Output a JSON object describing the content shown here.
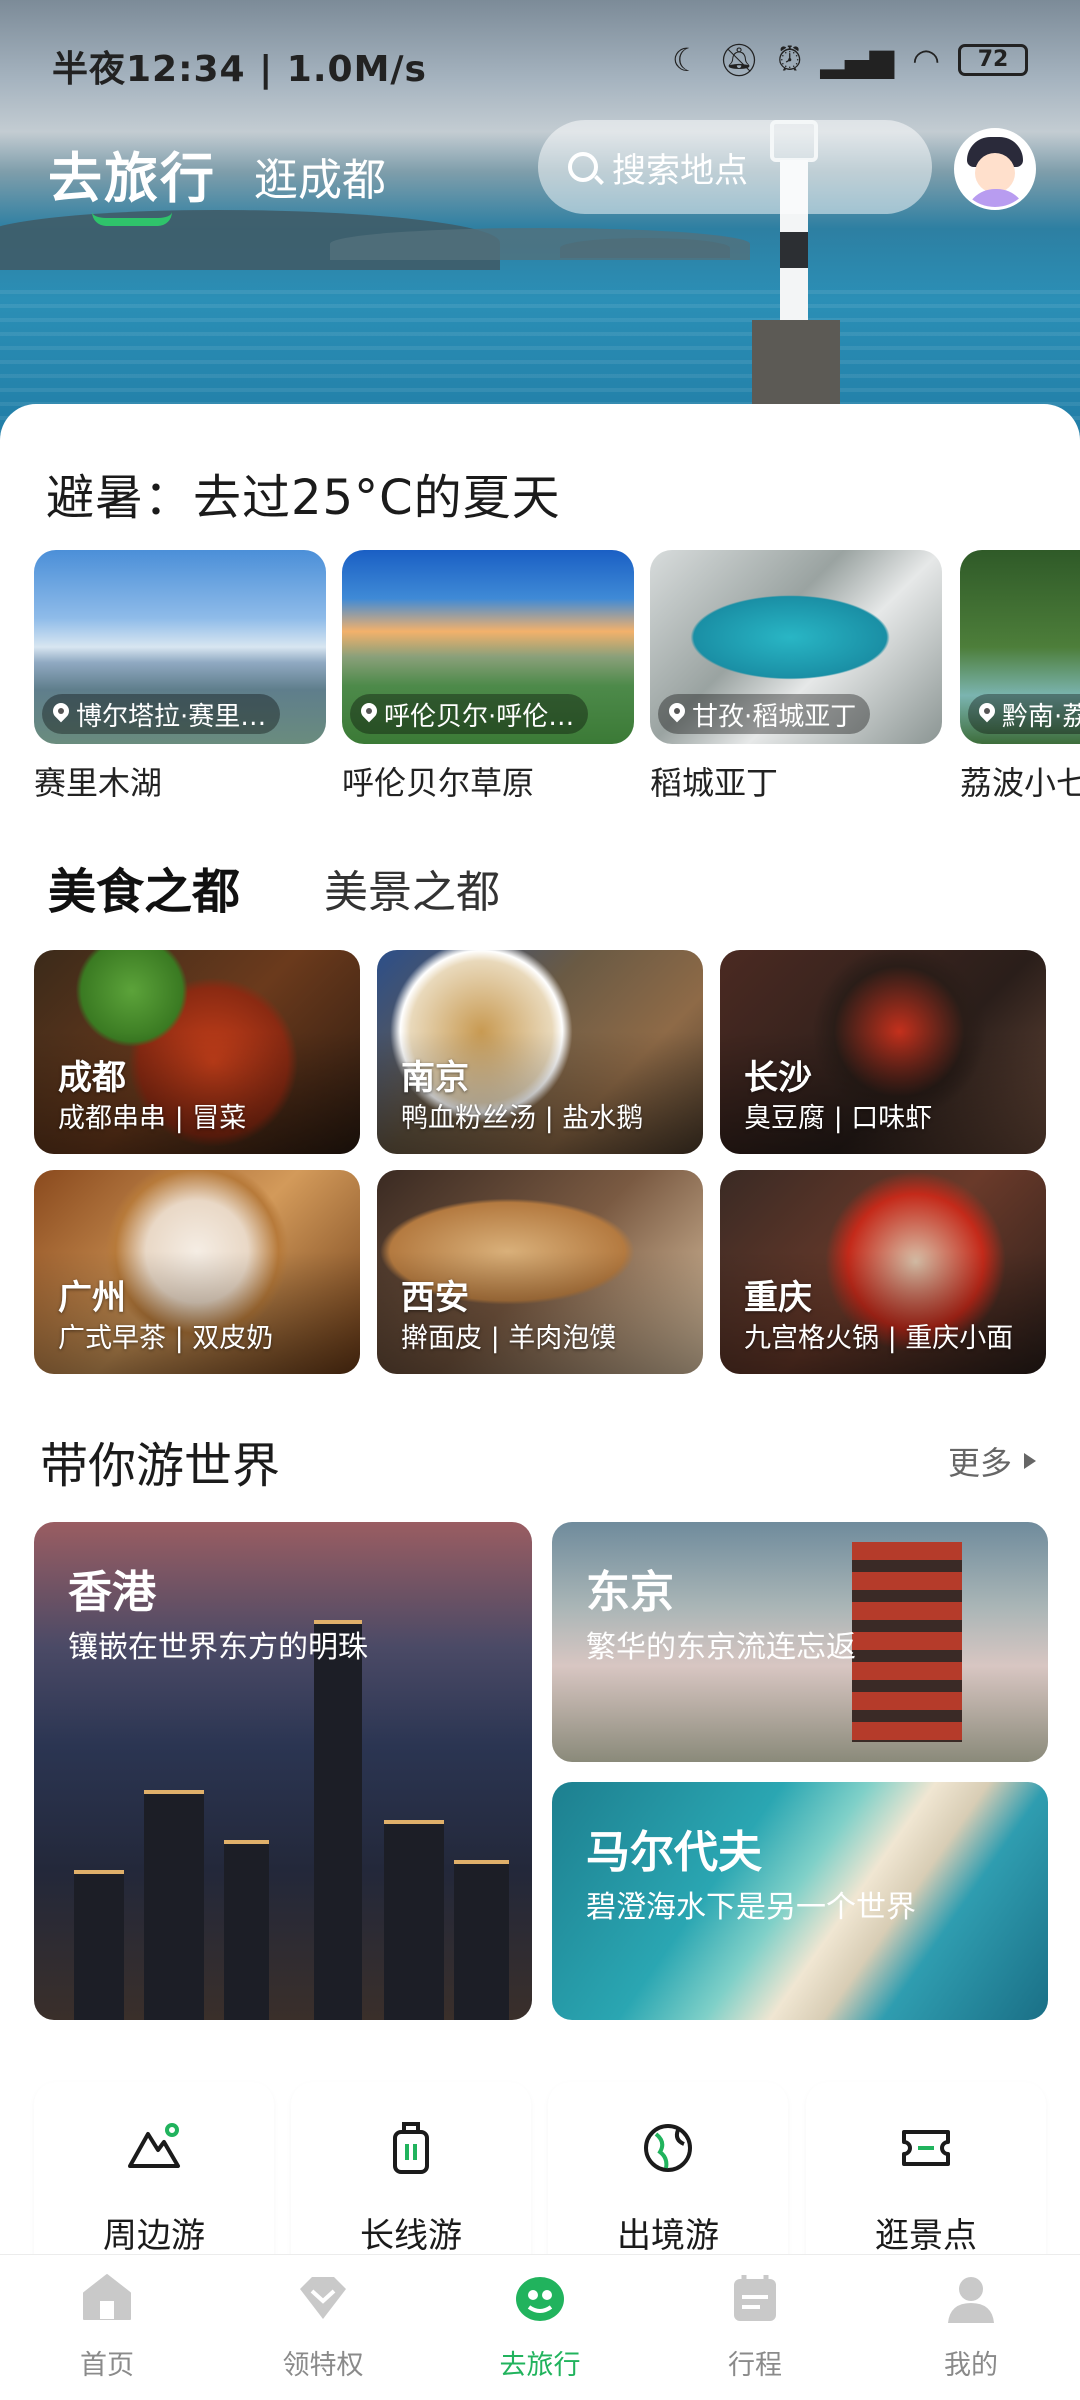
{
  "status_bar": {
    "time": "半夜12:34 | 1.0M/s",
    "battery": "72"
  },
  "header": {
    "tab_main": "去旅行",
    "tab_second": "逛成都",
    "search_placeholder": "搜索地点"
  },
  "summer": {
    "title": "避暑：去过25°C的夏天",
    "cards": [
      {
        "location": "博尔塔拉·赛里…",
        "name": "赛里木湖"
      },
      {
        "location": "呼伦贝尔·呼伦…",
        "name": "呼伦贝尔草原"
      },
      {
        "location": "甘孜·稻城亚丁",
        "name": "稻城亚丁"
      },
      {
        "location": "黔南·荔",
        "name": "荔波小七"
      }
    ]
  },
  "food_tabs": {
    "active": "美食之都",
    "inactive": "美景之都"
  },
  "food_cards": [
    {
      "city": "成都",
      "dishes": "成都串串 | 冒菜"
    },
    {
      "city": "南京",
      "dishes": "鸭血粉丝汤 | 盐水鹅"
    },
    {
      "city": "长沙",
      "dishes": "臭豆腐 | 口味虾"
    },
    {
      "city": "广州",
      "dishes": "广式早茶 | 双皮奶"
    },
    {
      "city": "西安",
      "dishes": "擀面皮 | 羊肉泡馍"
    },
    {
      "city": "重庆",
      "dishes": "九宫格火锅 | 重庆小面"
    }
  ],
  "world": {
    "title": "带你游世界",
    "more": "更多",
    "cards": [
      {
        "title": "香港",
        "subtitle": "镶嵌在世界东方的明珠"
      },
      {
        "title": "东京",
        "subtitle": "繁华的东京流连忘返"
      },
      {
        "title": "马尔代夫",
        "subtitle": "碧澄海水下是另一个世界"
      }
    ]
  },
  "quick_actions": [
    {
      "label": "周边游",
      "icon": "mountain-icon"
    },
    {
      "label": "长线游",
      "icon": "luggage-icon"
    },
    {
      "label": "出境游",
      "icon": "globe-icon"
    },
    {
      "label": "逛景点",
      "icon": "ticket-icon"
    }
  ],
  "tab_bar": [
    {
      "label": "首页",
      "icon": "home-icon"
    },
    {
      "label": "领特权",
      "icon": "diamond-icon"
    },
    {
      "label": "去旅行",
      "icon": "travel-icon",
      "active": true
    },
    {
      "label": "行程",
      "icon": "itinerary-icon"
    },
    {
      "label": "我的",
      "icon": "profile-icon"
    }
  ],
  "colors": {
    "accent": "#21b35d",
    "inactive_tab": "#8a8a8a"
  }
}
